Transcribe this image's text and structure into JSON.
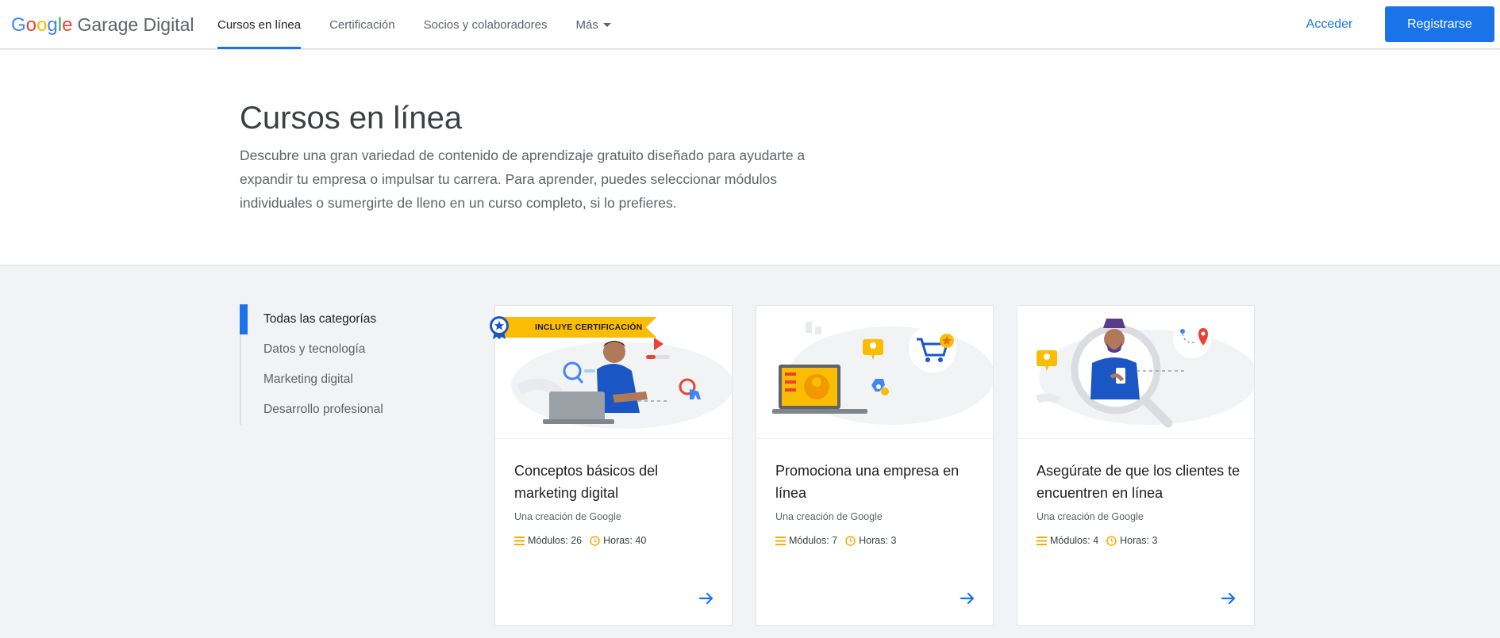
{
  "header": {
    "logo": {
      "google": [
        "G",
        "o",
        "o",
        "g",
        "l",
        "e"
      ],
      "product": "Garage Digital"
    },
    "nav": [
      {
        "label": "Cursos en línea",
        "active": true
      },
      {
        "label": "Certificación",
        "active": false
      },
      {
        "label": "Socios y colaboradores",
        "active": false
      },
      {
        "label": "Más",
        "active": false
      }
    ],
    "signin_label": "Acceder",
    "register_label": "Registrarse"
  },
  "hero": {
    "title": "Cursos en línea",
    "description": "Descubre una gran variedad de contenido de aprendizaje gratuito diseñado para ayudarte a expandir tu empresa o impulsar tu carrera. Para aprender, puedes seleccionar módulos individuales o sumergirte de lleno en un curso completo, si lo prefieres."
  },
  "sidebar": {
    "categories": [
      {
        "label": "Todas las categorías",
        "active": true
      },
      {
        "label": "Datos y tecnología",
        "active": false
      },
      {
        "label": "Marketing digital",
        "active": false
      },
      {
        "label": "Desarrollo profesional",
        "active": false
      }
    ]
  },
  "cards": [
    {
      "badge": "INCLUYE CERTIFICACIÓN",
      "title": "Conceptos básicos del marketing digital",
      "by": "Una creación de Google",
      "modules": "Módulos: 26",
      "hours": "Horas: 40"
    },
    {
      "title": "Promociona una empresa en línea",
      "by": "Una creación de Google",
      "modules": "Módulos: 7",
      "hours": "Horas: 3"
    },
    {
      "title": "Asegúrate de que los clientes te encuentren en línea",
      "by": "Una creación de Google",
      "modules": "Módulos: 4",
      "hours": "Horas: 3"
    }
  ],
  "colors": {
    "accent": "#1a73e8",
    "badge": "#fbbc04",
    "meta_icon": "#f9ab00"
  },
  "icons": {
    "modules": "list-icon",
    "hours": "clock-icon",
    "open": "arrow-right-icon",
    "more": "caret-down-icon"
  }
}
